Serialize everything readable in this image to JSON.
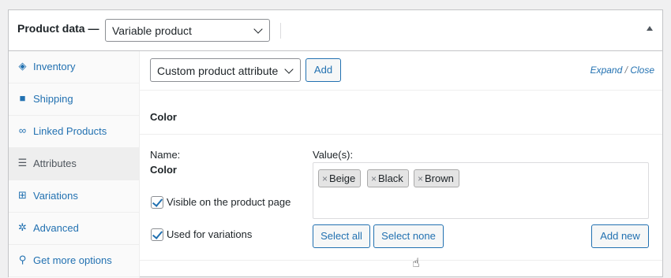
{
  "header": {
    "title": "Product data —",
    "product_type": "Variable product"
  },
  "tabs": [
    {
      "label": "Inventory",
      "icon": "tag-icon",
      "glyph": "◈"
    },
    {
      "label": "Shipping",
      "icon": "truck-icon",
      "glyph": "■"
    },
    {
      "label": "Linked Products",
      "icon": "link-icon",
      "glyph": "∞"
    },
    {
      "label": "Attributes",
      "icon": "list-icon",
      "glyph": "☰"
    },
    {
      "label": "Variations",
      "icon": "grid-icon",
      "glyph": "⊞"
    },
    {
      "label": "Advanced",
      "icon": "gear-icon",
      "glyph": "✲"
    },
    {
      "label": "Get more options",
      "icon": "plugin-icon",
      "glyph": "⚲"
    }
  ],
  "attributes": {
    "select_value": "Custom product attribute",
    "add_label": "Add",
    "expand_label": "Expand",
    "slash": "/",
    "close_label": "Close",
    "attribute_heading": "Color",
    "name_label": "Name:",
    "name_value": "Color",
    "values_label": "Value(s):",
    "values": [
      "Beige",
      "Black",
      "Brown"
    ],
    "chip_remove": "×",
    "visible_label": "Visible on the product page",
    "visible_checked": true,
    "variations_label": "Used for variations",
    "variations_checked": true,
    "select_all_label": "Select all",
    "select_none_label": "Select none",
    "add_new_label": "Add new"
  },
  "colors": {
    "accent": "#2271b1",
    "border": "#c3c4c7"
  }
}
